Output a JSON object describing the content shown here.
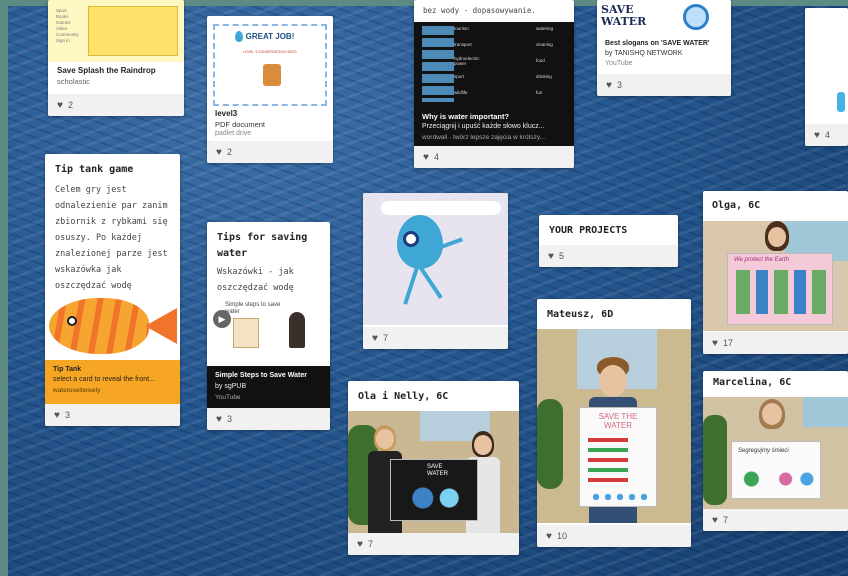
{
  "cards": {
    "splash": {
      "title": "Save Splash the Raindrop",
      "source": "scholastic",
      "likes": "2",
      "menu": [
        "Sport",
        "Books",
        "Games",
        "Video",
        "Community",
        "Sign in"
      ]
    },
    "level3": {
      "title": "level3",
      "type": "PDF document",
      "source": "padlet drive",
      "likes": "2",
      "cert_title": "GREAT JOB!",
      "cert_sub": "LEVEL 3 CONSERVATION HERO"
    },
    "wordwall": {
      "header": "bez wody - dopasowywanie.",
      "title": "Why is water important?",
      "desc": "Przeciągnij i upuść każde słowo klucz...",
      "source": "wordwall - twórz lepsze zajęcia w krótszy...",
      "likes": "4",
      "words": [
        "tourism",
        "watering",
        "transport",
        "cleaning",
        "hydroelectric power",
        "food",
        "sport",
        "drinking",
        "wildlife",
        "fun"
      ]
    },
    "slogans": {
      "banner": "SAVE WATER",
      "title": "Best slogans on 'SAVE WATER'",
      "by": "by TANISHQ NETWORK",
      "source": "YouTube",
      "likes": "3"
    },
    "right_top": {
      "likes": "4"
    },
    "tip_tank": {
      "title": "Tip tank game",
      "body": "Celem gry jest odnalezienie par zanim zbiornik z rybkami się osuszy. Po każdej znalezionej parze jest wskazówka jak oszczędzać wodę",
      "link_title": "Tip Tank",
      "link_desc": "select a card to reveal the front...",
      "link_src": "wateruseitwisely",
      "likes": "3"
    },
    "tips_saving": {
      "title": "Tips for saving water",
      "body": "Wskazówki - jak oszczędzać wodę",
      "thumb_text": "Simple steps to save water",
      "link_title": "Simple Steps to Save Water",
      "link_by": "by sgPUB",
      "link_src": "YouTube",
      "likes": "3"
    },
    "drop": {
      "likes": "7"
    },
    "projects": {
      "title": "YOUR PROJECTS",
      "likes": "5"
    },
    "olga": {
      "title": "Olga, 6C",
      "poster_text": "We protect the Earth",
      "likes": "17"
    },
    "mateusz": {
      "title": "Mateusz, 6D",
      "poster_text": "SAVE THE WATER",
      "likes": "10"
    },
    "ola": {
      "title": "Ola i Nelly, 6C",
      "poster_text": "SAVE WATER",
      "likes": "7"
    },
    "marcelina": {
      "title": "Marcelina, 6C",
      "poster_text": "Segregujmy śmieci",
      "likes": "7"
    }
  },
  "icons": {
    "like": "heart-icon",
    "play": "play-icon"
  },
  "colors": {
    "background": "#24568e",
    "frame": "#5d8a82",
    "tip_tank_band": "#f6a623",
    "drop": "#3fa7d6"
  }
}
